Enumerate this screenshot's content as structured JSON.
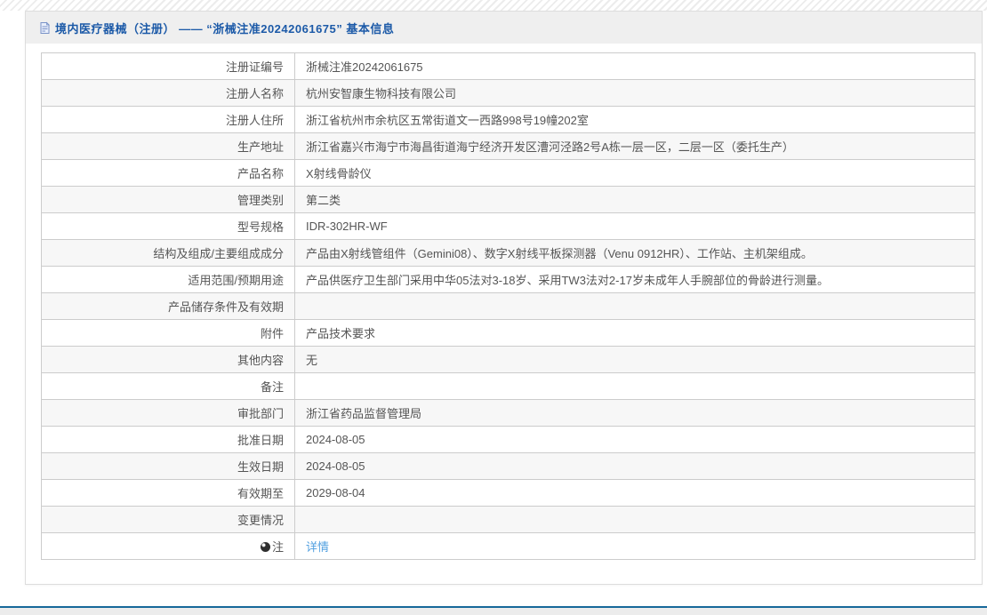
{
  "page": {
    "title": "境内医疗器械（注册） —— “浙械注准20242061675” 基本信息"
  },
  "icons": {
    "header": "document-icon",
    "note_row": "note-icon"
  },
  "colors": {
    "title_blue": "#1c5aa8",
    "link_blue": "#52a0e0",
    "footer_line_blue": "#17689a",
    "row_alt_gray": "#f7f7f7",
    "header_bar_gray": "#efefef",
    "text_gray": "#555555"
  },
  "table": {
    "rows": [
      {
        "label": "注册证编号",
        "value": "浙械注准20242061675"
      },
      {
        "label": "注册人名称",
        "value": "杭州安智康生物科技有限公司"
      },
      {
        "label": "注册人住所",
        "value": "浙江省杭州市余杭区五常街道文一西路998号19幢202室"
      },
      {
        "label": "生产地址",
        "value": "浙江省嘉兴市海宁市海昌街道海宁经济开发区漕河泾路2号A栋一层一区，二层一区（委托生产）"
      },
      {
        "label": "产品名称",
        "value": "X射线骨龄仪"
      },
      {
        "label": "管理类别",
        "value": "第二类"
      },
      {
        "label": "型号规格",
        "value": "IDR-302HR-WF"
      },
      {
        "label": "结构及组成/主要组成成分",
        "value": "产品由X射线管组件（Gemini08）、数字X射线平板探测器（Venu 0912HR）、工作站、主机架组成。"
      },
      {
        "label": "适用范围/预期用途",
        "value": "产品供医疗卫生部门采用中华05法对3-18岁、采用TW3法对2-17岁未成年人手腕部位的骨龄进行测量。"
      },
      {
        "label": "产品储存条件及有效期",
        "value": ""
      },
      {
        "label": "附件",
        "value": "产品技术要求"
      },
      {
        "label": "其他内容",
        "value": "无"
      },
      {
        "label": "备注",
        "value": ""
      },
      {
        "label": "审批部门",
        "value": "浙江省药品监督管理局"
      },
      {
        "label": "批准日期",
        "value": "2024-08-05"
      },
      {
        "label": "生效日期",
        "value": "2024-08-05"
      },
      {
        "label": "有效期至",
        "value": "2029-08-04"
      },
      {
        "label": "变更情况",
        "value": ""
      },
      {
        "label": "注",
        "value": "详情",
        "is_link": true,
        "has_icon": true
      }
    ]
  }
}
